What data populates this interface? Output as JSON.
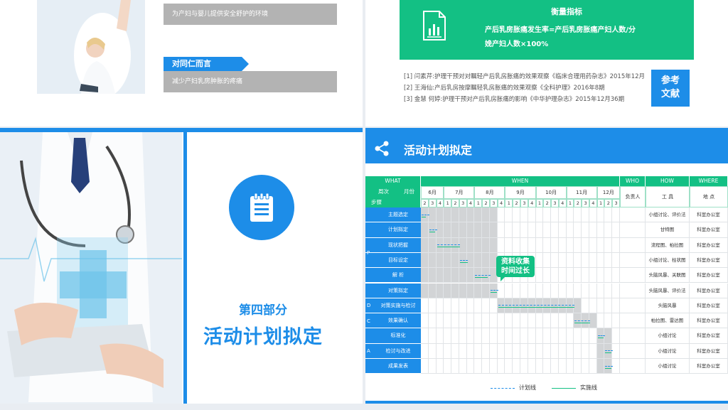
{
  "slide1": {
    "bar1_text": "为产妇与婴儿提供安全舒护的环境",
    "tag2": "对同仁而言",
    "bar2_text": "减少产妇乳房肿胀的疼痛"
  },
  "slide2": {
    "metric_title": "衡量指标",
    "metric_line1": "产后乳房胀痛发生率=产后乳房胀痛产妇人数/分",
    "metric_line2": "娩产妇人数×100%",
    "refs": [
      "[1] 闫素芹:护理干预对对瞩轻产后乳房胀痛的效果观察《临床合理用药杂志》2015年12月",
      "[2] 王海仙:产后乳房按摩瞩轻乳房胀痛的效果观察《全科护理》2016年8期",
      "[3] 金慧 何婷:护理干预对产后乳房胀痛的影响《中华护理杂志》2015年12月36期"
    ],
    "ref_badge_line1": "参考",
    "ref_badge_line2": "文献"
  },
  "slide3": {
    "part": "第四部分",
    "title": "活动计划拟定"
  },
  "slide4": {
    "title": "活动计划拟定",
    "headers": {
      "what": "WHAT",
      "when": "WHEN",
      "who": "WHO",
      "how": "HOW",
      "where": "WHERE"
    },
    "sub": {
      "week": "周次",
      "month": "月份",
      "step": "步骤",
      "person": "负责人",
      "tool": "工 具",
      "place": "地 点"
    },
    "months": [
      "6月",
      "7月",
      "8月",
      "9月",
      "10月",
      "11月",
      "12月"
    ],
    "weeks": [
      "2",
      "3",
      "4",
      "1",
      "2",
      "3",
      "4",
      "1",
      "2",
      "3",
      "4",
      "1",
      "2",
      "3",
      "4",
      "1",
      "2",
      "3",
      "4",
      "1",
      "2",
      "3",
      "4",
      "1",
      "2",
      "3"
    ],
    "phases": [
      "P",
      "D",
      "C",
      "A"
    ],
    "steps": [
      {
        "name": "主题选定",
        "tool": "小组讨论、评价法",
        "place": "科室办公室"
      },
      {
        "name": "计划拟定",
        "tool": "甘特图",
        "place": "科室办公室"
      },
      {
        "name": "现状把握",
        "tool": "流程图、柏拉图",
        "place": "科室办公室"
      },
      {
        "name": "目标设定",
        "tool": "小组讨论、柱状图",
        "place": "科室办公室"
      },
      {
        "name": "解 析",
        "tool": "头脑风暴、关联图",
        "place": "科室办公室"
      },
      {
        "name": "对策拟定",
        "tool": "头脑风暴、评价法",
        "place": "科室办公室"
      },
      {
        "name": "对策实施与检讨",
        "tool": "头脑风暴",
        "place": "科室办公室"
      },
      {
        "name": "效果确认",
        "tool": "柏拉图、雷达图",
        "place": "科室办公室"
      },
      {
        "name": "标准化",
        "tool": "小组讨论",
        "place": "科室办公室"
      },
      {
        "name": "检讨与改进",
        "tool": "小组讨论",
        "place": "科室办公室"
      },
      {
        "name": "成果发表",
        "tool": "小组讨论",
        "place": "科室办公室"
      }
    ],
    "callout_line1": "资料收集",
    "callout_line2": "时间过长",
    "legend_plan": "计划线",
    "legend_actual": "实施线",
    "colors": {
      "green": "#13c084",
      "blue": "#1d8de8"
    }
  }
}
